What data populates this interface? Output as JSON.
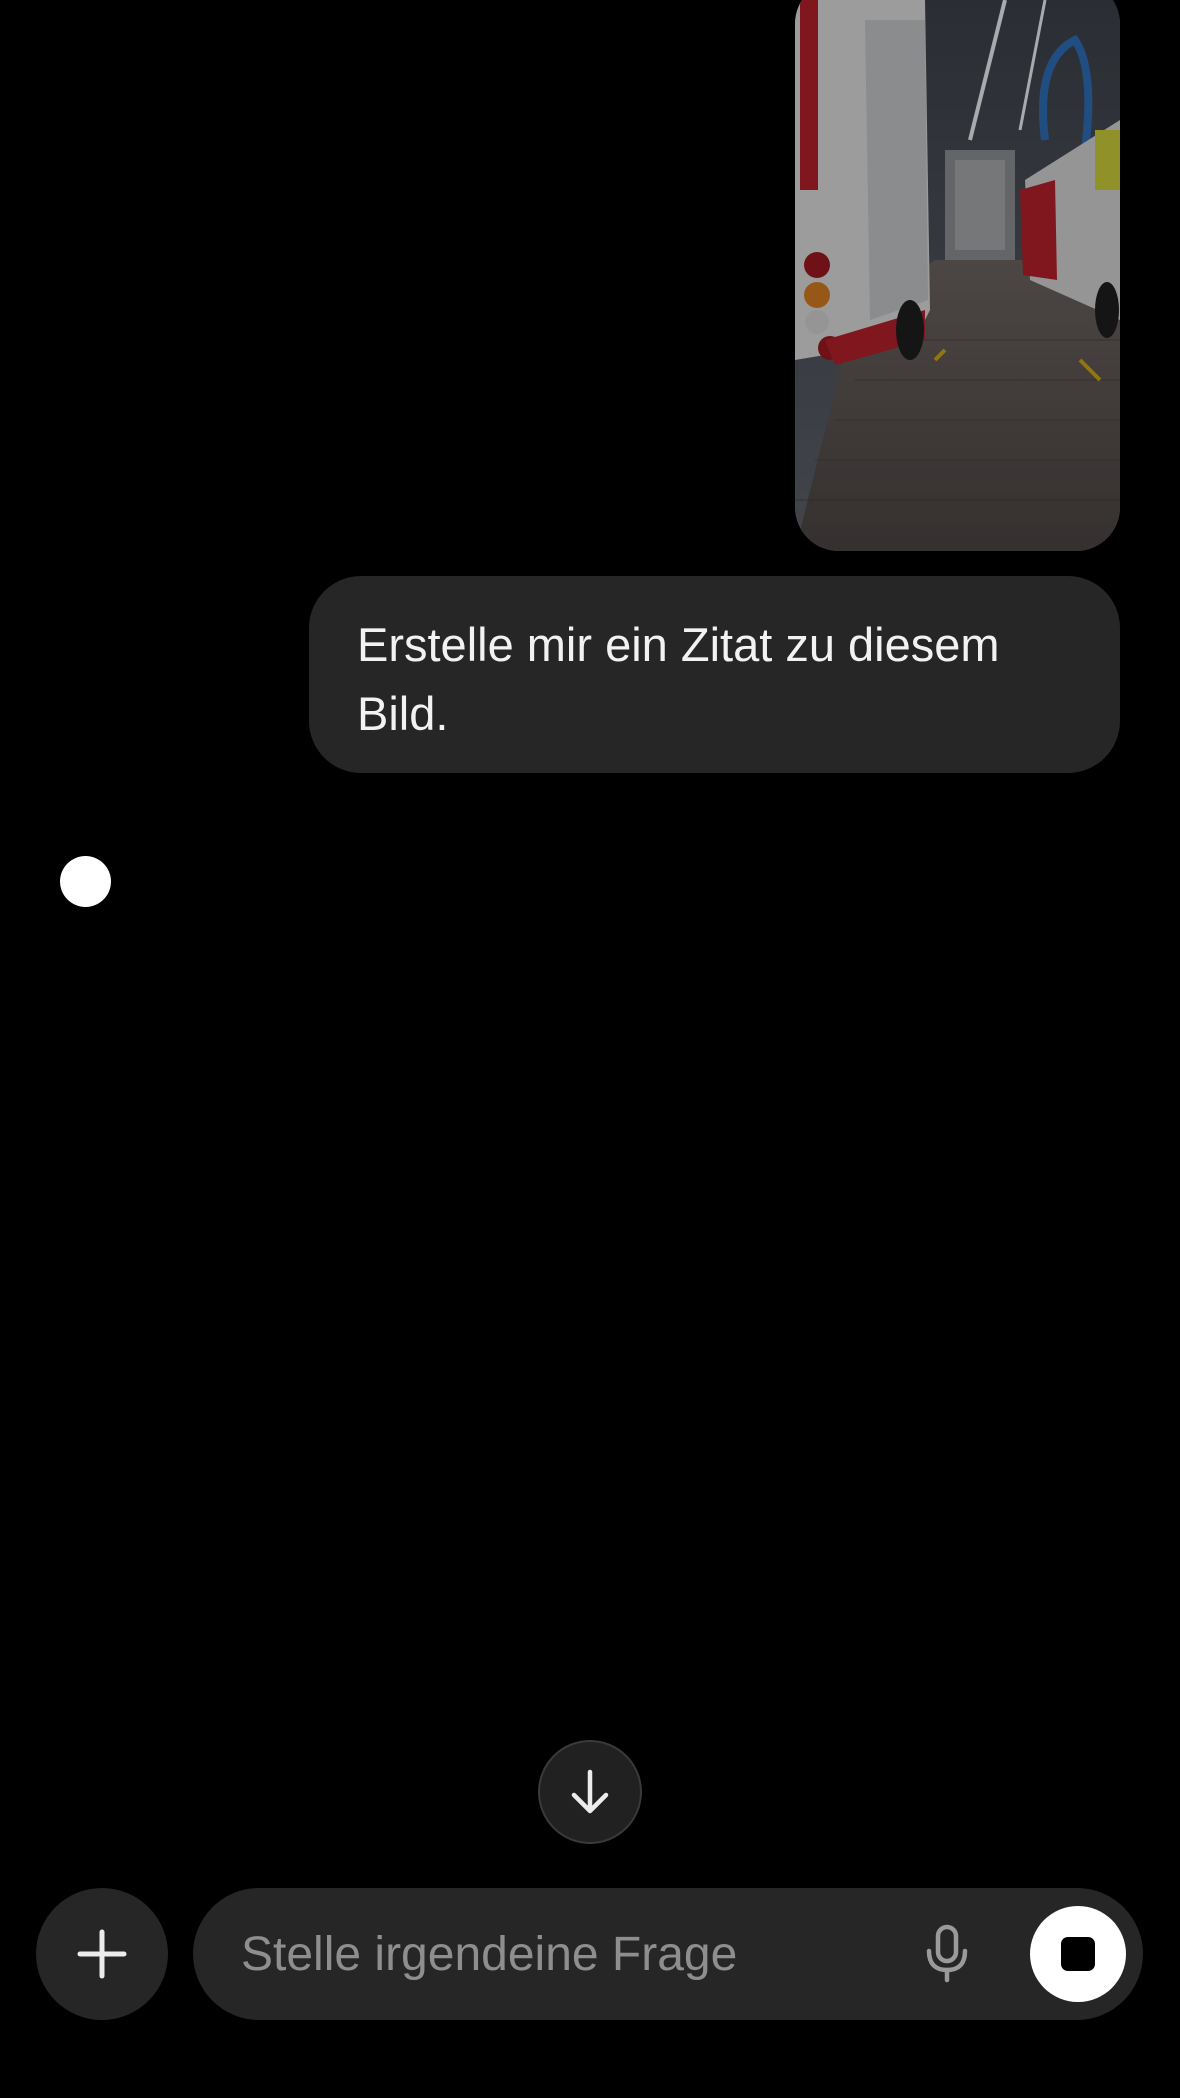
{
  "conversation": {
    "image_attachment": {
      "icon": "photo-fire-truck-garage"
    },
    "user_message": "Erstelle mir ein Zitat zu diesem Bild.",
    "assistant_status_icon": "thinking-dot"
  },
  "composer": {
    "placeholder": "Stelle irgendeine Frage",
    "icons": {
      "add": "plus-icon",
      "mic": "microphone-icon",
      "stop": "stop-icon",
      "scroll": "arrow-down-icon"
    }
  },
  "colors": {
    "background": "#000000",
    "bubble": "#262626",
    "text": "#f2f2f2",
    "placeholder": "#8e8e8e",
    "stop_button": "#ffffff"
  }
}
